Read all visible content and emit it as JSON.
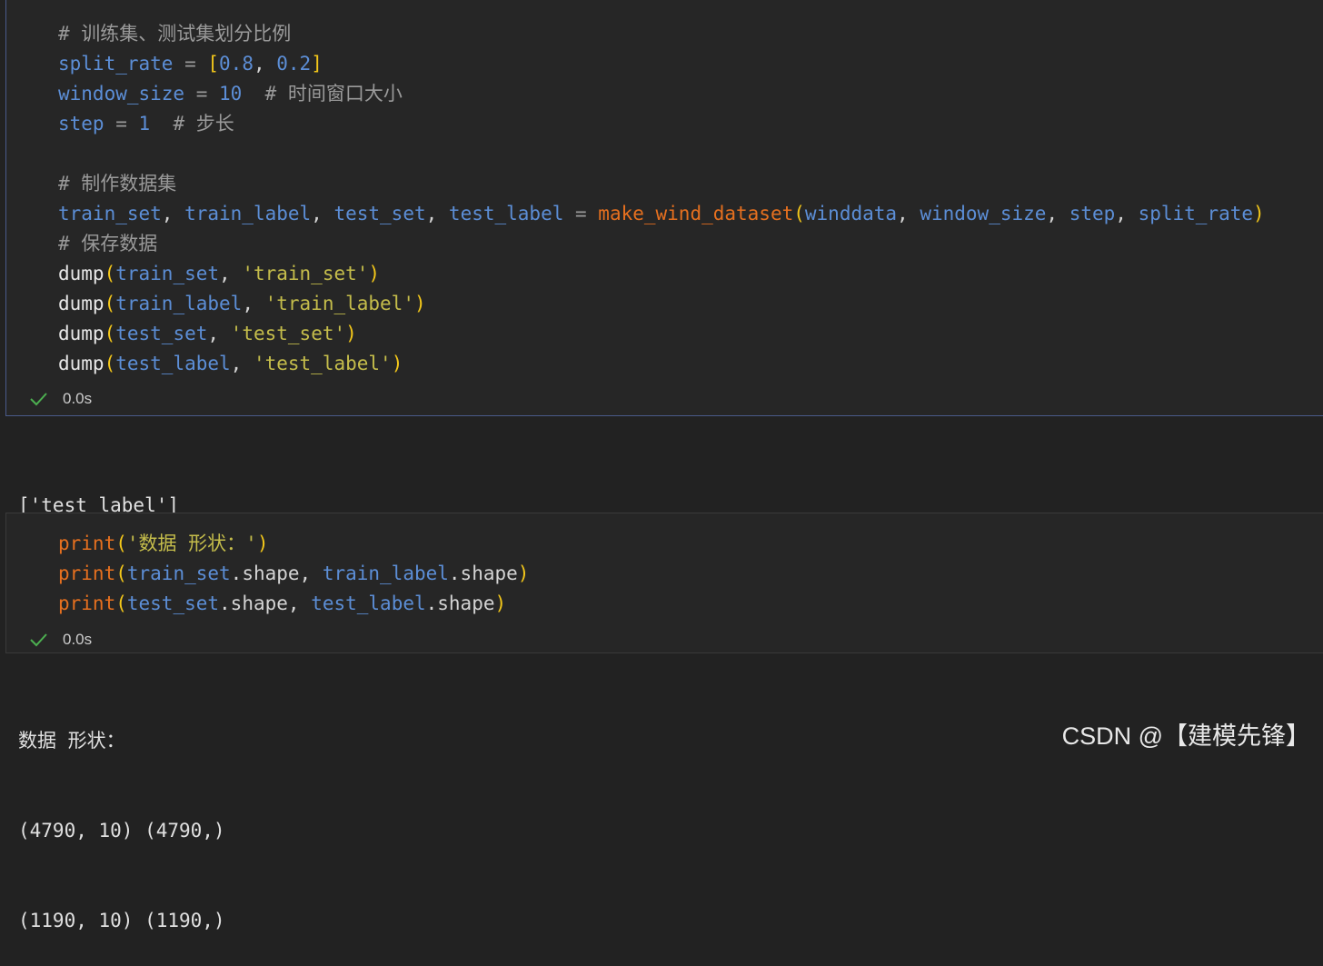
{
  "cell1": {
    "lines": [
      [
        {
          "t": "# 训练集、测试集划分比例",
          "c": "cm"
        }
      ],
      [
        {
          "t": "split_rate",
          "c": "var"
        },
        {
          "t": " = ",
          "c": "op"
        },
        {
          "t": "[",
          "c": "br"
        },
        {
          "t": "0.8",
          "c": "num"
        },
        {
          "t": ", ",
          "c": "pl"
        },
        {
          "t": "0.2",
          "c": "num"
        },
        {
          "t": "]",
          "c": "br"
        }
      ],
      [
        {
          "t": "window_size",
          "c": "var"
        },
        {
          "t": " = ",
          "c": "op"
        },
        {
          "t": "10",
          "c": "num"
        },
        {
          "t": "  # 时间窗口大小",
          "c": "cm"
        }
      ],
      [
        {
          "t": "step",
          "c": "var"
        },
        {
          "t": " = ",
          "c": "op"
        },
        {
          "t": "1",
          "c": "num"
        },
        {
          "t": "  # 步长",
          "c": "cm"
        }
      ],
      [],
      [
        {
          "t": "# 制作数据集",
          "c": "cm"
        }
      ],
      [
        {
          "t": "train_set",
          "c": "var"
        },
        {
          "t": ", ",
          "c": "pl"
        },
        {
          "t": "train_label",
          "c": "var"
        },
        {
          "t": ", ",
          "c": "pl"
        },
        {
          "t": "test_set",
          "c": "var"
        },
        {
          "t": ", ",
          "c": "pl"
        },
        {
          "t": "test_label",
          "c": "var"
        },
        {
          "t": " = ",
          "c": "op"
        },
        {
          "t": "make_wind_dataset",
          "c": "fn"
        },
        {
          "t": "(",
          "c": "br"
        },
        {
          "t": "winddata",
          "c": "var"
        },
        {
          "t": ", ",
          "c": "pl"
        },
        {
          "t": "window_size",
          "c": "var"
        },
        {
          "t": ", ",
          "c": "pl"
        },
        {
          "t": "step",
          "c": "var"
        },
        {
          "t": ", ",
          "c": "pl"
        },
        {
          "t": "split_rate",
          "c": "var"
        },
        {
          "t": ")",
          "c": "br"
        }
      ],
      [
        {
          "t": "# 保存数据",
          "c": "cm"
        }
      ],
      [
        {
          "t": "dump",
          "c": "fw"
        },
        {
          "t": "(",
          "c": "br"
        },
        {
          "t": "train_set",
          "c": "var"
        },
        {
          "t": ", ",
          "c": "pl"
        },
        {
          "t": "'train_set'",
          "c": "str"
        },
        {
          "t": ")",
          "c": "br"
        }
      ],
      [
        {
          "t": "dump",
          "c": "fw"
        },
        {
          "t": "(",
          "c": "br"
        },
        {
          "t": "train_label",
          "c": "var"
        },
        {
          "t": ", ",
          "c": "pl"
        },
        {
          "t": "'train_label'",
          "c": "str"
        },
        {
          "t": ")",
          "c": "br"
        }
      ],
      [
        {
          "t": "dump",
          "c": "fw"
        },
        {
          "t": "(",
          "c": "br"
        },
        {
          "t": "test_set",
          "c": "var"
        },
        {
          "t": ", ",
          "c": "pl"
        },
        {
          "t": "'test_set'",
          "c": "str"
        },
        {
          "t": ")",
          "c": "br"
        }
      ],
      [
        {
          "t": "dump",
          "c": "fw"
        },
        {
          "t": "(",
          "c": "br"
        },
        {
          "t": "test_label",
          "c": "var"
        },
        {
          "t": ", ",
          "c": "pl"
        },
        {
          "t": "'test_label'",
          "c": "str"
        },
        {
          "t": ")",
          "c": "br"
        }
      ]
    ],
    "status_time": "0.0s",
    "output": [
      "['test_label']"
    ]
  },
  "cell2": {
    "lines": [
      [
        {
          "t": "print",
          "c": "fn"
        },
        {
          "t": "(",
          "c": "br"
        },
        {
          "t": "'数据 形状：'",
          "c": "str"
        },
        {
          "t": ")",
          "c": "br"
        }
      ],
      [
        {
          "t": "print",
          "c": "fn"
        },
        {
          "t": "(",
          "c": "br"
        },
        {
          "t": "train_set",
          "c": "var"
        },
        {
          "t": ".shape",
          "c": "pl"
        },
        {
          "t": ", ",
          "c": "pl"
        },
        {
          "t": "train_label",
          "c": "var"
        },
        {
          "t": ".shape",
          "c": "pl"
        },
        {
          "t": ")",
          "c": "br"
        }
      ],
      [
        {
          "t": "print",
          "c": "fn"
        },
        {
          "t": "(",
          "c": "br"
        },
        {
          "t": "test_set",
          "c": "var"
        },
        {
          "t": ".shape",
          "c": "pl"
        },
        {
          "t": ", ",
          "c": "pl"
        },
        {
          "t": "test_label",
          "c": "var"
        },
        {
          "t": ".shape",
          "c": "pl"
        },
        {
          "t": ")",
          "c": "br"
        }
      ]
    ],
    "status_time": "0.0s",
    "output": [
      "数据 形状：",
      "(4790, 10) (4790,)",
      "(1190, 10) (1190,)"
    ]
  },
  "watermark": "CSDN @【建模先锋】",
  "icons": {
    "status": "check-icon"
  },
  "colors": {
    "check": "#4caf50",
    "comment": "#9a9a9a",
    "variable": "#5c8ed6",
    "function": "#e6701f",
    "string": "#c5bd4b",
    "bracket": "#f3c71a"
  }
}
